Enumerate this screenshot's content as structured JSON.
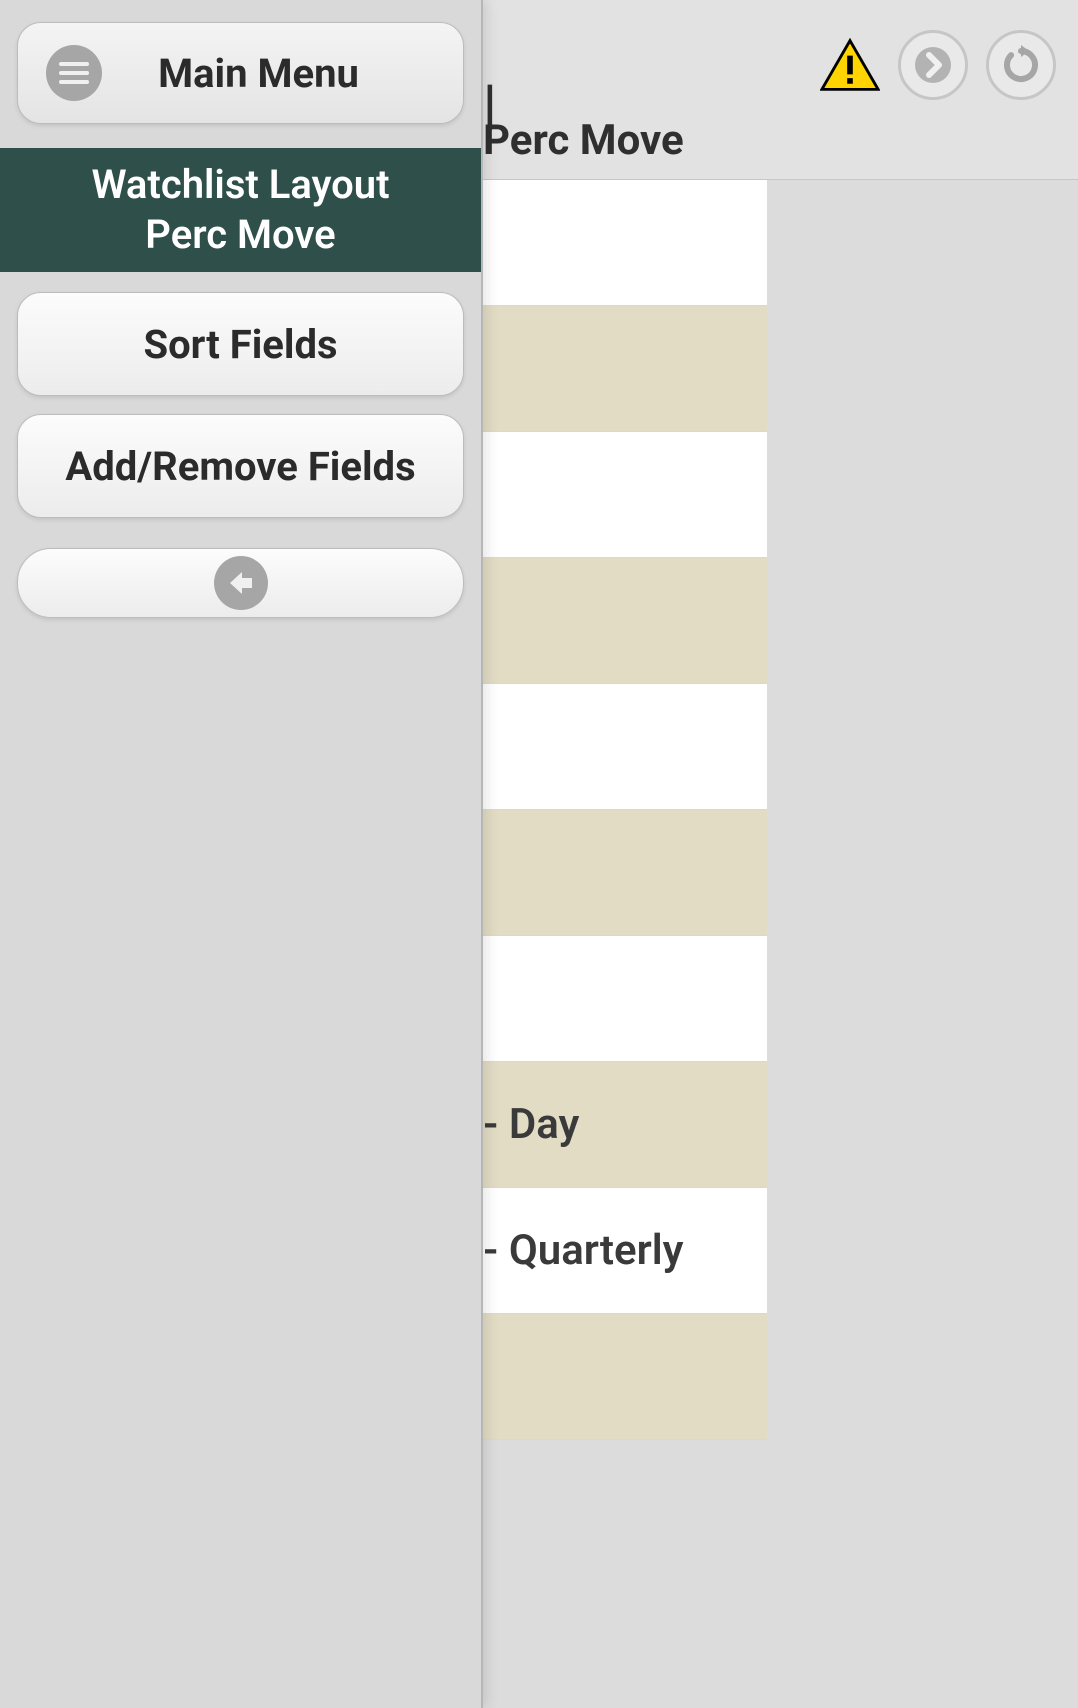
{
  "header": {
    "subtitle_visible": "Perc Move",
    "title_snippet": "|"
  },
  "sidebar": {
    "main_menu_label": "Main Menu",
    "selected_banner_line1": "Watchlist Layout",
    "selected_banner_line2": "Perc Move",
    "items": [
      {
        "label": "Sort Fields"
      },
      {
        "label": "Add/Remove Fields"
      }
    ]
  },
  "list": {
    "rows": [
      {
        "label": ""
      },
      {
        "label": ""
      },
      {
        "label": ""
      },
      {
        "label": ""
      },
      {
        "label": ""
      },
      {
        "label": ""
      },
      {
        "label": ""
      },
      {
        "label": "- Day"
      },
      {
        "label": "- Quarterly"
      },
      {
        "label": ""
      }
    ]
  }
}
